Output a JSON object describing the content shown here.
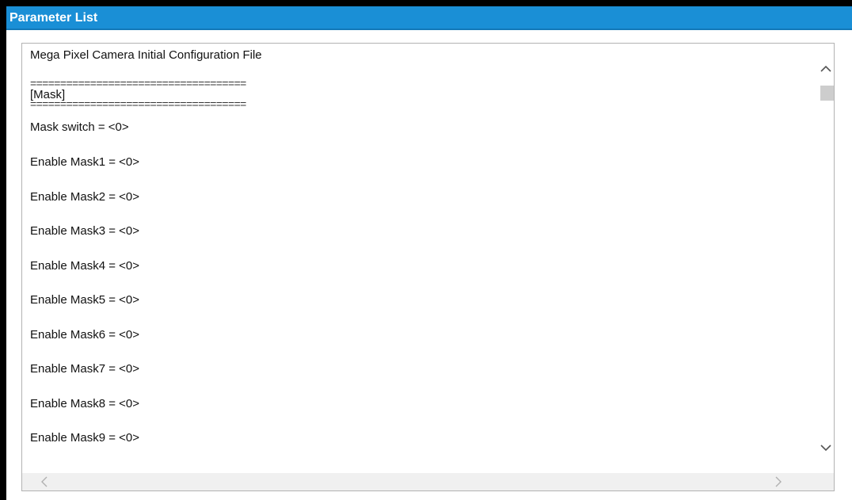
{
  "panel": {
    "title": "Parameter List"
  },
  "config": {
    "header": "Mega Pixel Camera Initial Configuration File",
    "separator": "====================================",
    "section": "[Mask]",
    "lines": [
      "Mask switch = <0>",
      "Enable Mask1 = <0>",
      "Enable Mask2 = <0>",
      "Enable Mask3 = <0>",
      "Enable Mask4 = <0>",
      "Enable Mask5 = <0>",
      "Enable Mask6 = <0>",
      "Enable Mask7 = <0>",
      "Enable Mask8 = <0>",
      "Enable Mask9 = <0>"
    ]
  },
  "icons": {
    "scroll_up": "chevron-up-icon",
    "scroll_down": "chevron-down-icon",
    "scroll_left": "chevron-left-icon",
    "scroll_right": "chevron-right-icon"
  },
  "colors": {
    "title_bar": "#1a8fd6",
    "title_text": "#ffffff",
    "border": "#b3b3b3",
    "scroll_thumb": "#cdcdcd"
  }
}
